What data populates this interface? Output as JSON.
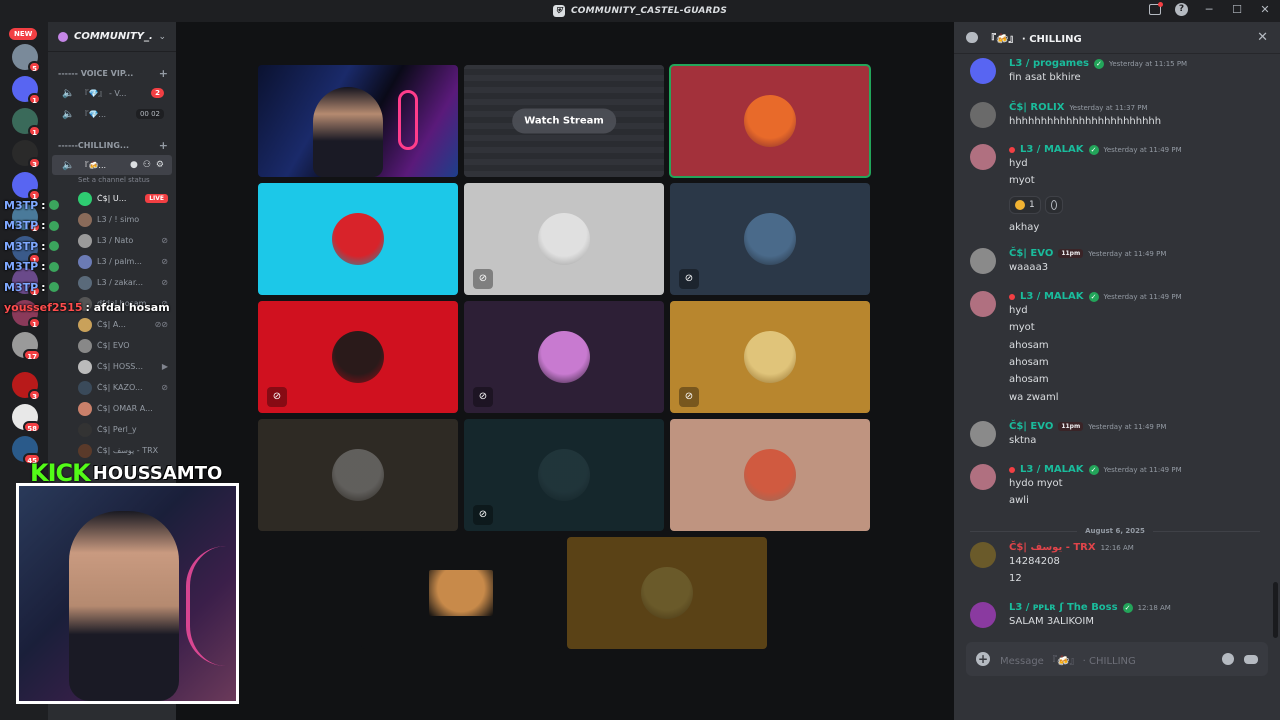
{
  "window": {
    "title": "COMMUNITY_CASTEL-GUARDS",
    "controls": [
      "inbox-icon",
      "help-icon",
      "minimize",
      "maximize",
      "close"
    ]
  },
  "rail": {
    "new_label": "NEW",
    "badges": [
      "5",
      "1",
      "1",
      "3",
      "1",
      "1",
      "1",
      "1",
      "1",
      "1",
      "17",
      "3",
      "58",
      "45"
    ]
  },
  "sidebar": {
    "server_name": "COMMUNITY_...",
    "categories": [
      {
        "label": "------ VOICE VIP..."
      },
      {
        "label": "------CHILLING..."
      }
    ],
    "channels": [
      {
        "name": "『💎』 - V...",
        "count": "2"
      },
      {
        "name": "『💎...",
        "pill": "00 02"
      },
      {
        "name": "『🍻...",
        "active": true
      }
    ],
    "status_placeholder": "Set a channel status",
    "members": [
      {
        "name": "Č$| U...",
        "live": "LIVE",
        "color": "#2ecc71"
      },
      {
        "name": "L3 / ! simo",
        "color": "#8a6b5a"
      },
      {
        "name": "L3 / Nato",
        "color": "#9a9a9a"
      },
      {
        "name": "L3 / palm...",
        "color": "#6b7bb5"
      },
      {
        "name": "L3 / zakar...",
        "color": "#5a6a7a"
      },
      {
        "name": "dfdal hosam",
        "color": "#555"
      },
      {
        "name": "Č$| A...",
        "color": "#c9a15a"
      },
      {
        "name": "Č$| EVO",
        "color": "#888"
      },
      {
        "name": "Č$| HOSS...",
        "color": "#bbb"
      },
      {
        "name": "Č$| KAZO...",
        "color": "#3a4a5a"
      },
      {
        "name": "Č$| OMAR A...",
        "color": "#c9806a"
      },
      {
        "name": "Č$| Perl_y",
        "color": "#333"
      },
      {
        "name": "Č$| يوسف - TRX",
        "color": "#5a3a2a"
      }
    ]
  },
  "overlay_chat": {
    "lines": [
      {
        "user": "M3TP",
        "text": ":"
      },
      {
        "user": "M3TP",
        "text": ":"
      },
      {
        "user": "M3TP",
        "text": ":"
      },
      {
        "user": "M3TP",
        "text": ":"
      },
      {
        "user": "M3TP",
        "text": ":"
      },
      {
        "user": "youssef2515",
        "text": ": afdal hosam"
      }
    ]
  },
  "webcam": {
    "platform": "KICK",
    "handle": "HOUSSAMTO"
  },
  "stage": {
    "watch_stream_label": "Watch Stream",
    "tiles": [
      {
        "kind": "video",
        "bg": "#0b1230"
      },
      {
        "kind": "stream",
        "bg": "#2a2c31"
      },
      {
        "kind": "avatar",
        "bg": "#a3313b",
        "avatar": "#e86a2a",
        "speaking": true
      },
      {
        "kind": "avatar",
        "bg": "#1cc8e8",
        "avatar": "#d8232a"
      },
      {
        "kind": "avatar",
        "bg": "#c4c4c4",
        "avatar": "#e0e0e0",
        "muted": true
      },
      {
        "kind": "avatar",
        "bg": "#2b3848",
        "avatar": "#4a6a8a",
        "muted": true
      },
      {
        "kind": "avatar",
        "bg": "#d0111f",
        "avatar": "#2a1a1a",
        "muted": true
      },
      {
        "kind": "avatar",
        "bg": "#2d1f36",
        "avatar": "#c87ad0",
        "muted": true
      },
      {
        "kind": "avatar",
        "bg": "#b8862e",
        "avatar": "#e0c47a",
        "muted": true
      },
      {
        "kind": "avatar",
        "bg": "#2e2a24",
        "avatar": "#8a8a8a",
        "dim": true
      },
      {
        "kind": "avatar",
        "bg": "#15272c",
        "avatar": "#2a4046",
        "muted": true,
        "dim": true
      },
      {
        "kind": "avatar",
        "bg": "#bf9480",
        "avatar": "#d05a40"
      },
      {
        "kind": "avatar",
        "bg": "#111214",
        "avatar": "#c88a4a",
        "square": true
      },
      {
        "kind": "avatar",
        "bg": "#5a4216",
        "avatar": "#6a5a2a"
      }
    ]
  },
  "chat": {
    "channel": "『🍻』 · CHILLING",
    "messages": [
      {
        "user": "L3 / progames",
        "time": "Yesterday at 11:15 PM",
        "lines": [
          "fin asat bkhire"
        ],
        "color": "teal",
        "avatar": "#5865f2",
        "verified": true
      },
      {
        "user": "Č$| ROLIX",
        "time": "Yesterday at 11:37 PM",
        "lines": [
          "hhhhhhhhhhhhhhhhhhhhhhhh"
        ],
        "color": "teal",
        "avatar": "#6a6a6a"
      },
      {
        "user": "L3 / MALAK",
        "time": "Yesterday at 11:49 PM",
        "lines": [
          "hyd",
          "myot"
        ],
        "color": "teal",
        "avatar": "#b07080",
        "verified": true,
        "reddot": true,
        "reaction_count": "1",
        "after": [
          "akhay"
        ]
      },
      {
        "user": "Č$| EVO",
        "tag": "11pm",
        "time": "Yesterday at 11:49 PM",
        "lines": [
          "waaaa3"
        ],
        "color": "teal",
        "avatar": "#8a8a8a"
      },
      {
        "user": "L3 / MALAK",
        "time": "Yesterday at 11:49 PM",
        "lines": [
          "hyd",
          "myot",
          "ahosam",
          "ahosam",
          "ahosam",
          "wa zwaml"
        ],
        "color": "teal",
        "avatar": "#b07080",
        "verified": true,
        "reddot": true
      },
      {
        "user": "Č$| EVO",
        "tag": "11pm",
        "time": "Yesterday at 11:49 PM",
        "lines": [
          "sktna"
        ],
        "color": "teal",
        "avatar": "#8a8a8a"
      },
      {
        "user": "L3 / MALAK",
        "time": "Yesterday at 11:49 PM",
        "lines": [
          "hydo  myot",
          "awli"
        ],
        "color": "teal",
        "avatar": "#b07080",
        "verified": true,
        "reddot": true
      },
      {
        "user": "Č$| يوسف - TRX",
        "time": "12:16 AM",
        "lines": [
          "14284208",
          "12"
        ],
        "color": "red",
        "avatar": "#6a5a2a"
      },
      {
        "user": "L3 / ᴘᴘʟʀ ʃ The Boss",
        "time": "12:18 AM",
        "lines": [
          "SALAM 3ALIKOIM"
        ],
        "color": "teal",
        "avatar": "#8a3aa0",
        "verified": true
      }
    ],
    "date_divider": "August 6, 2025",
    "composer_placeholder": "Message 『🍻』 · CHILLING"
  }
}
